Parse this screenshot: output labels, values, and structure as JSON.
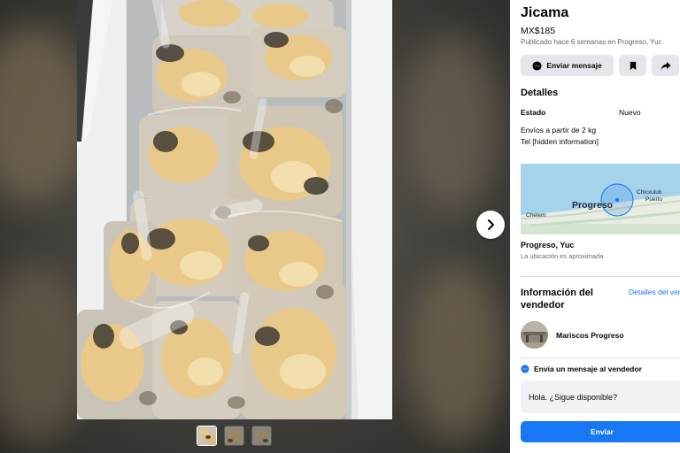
{
  "listing": {
    "title": "Jicama",
    "price": "MX$185",
    "posted": "Publicado hace 6 semanas en Progreso, Yuc"
  },
  "actions": {
    "message_label": "Enviar mensaje",
    "icons": [
      "messenger-icon",
      "bookmark-icon",
      "share-icon"
    ]
  },
  "details": {
    "heading": "Detalles",
    "condition_label": "Estado",
    "condition_value": "Nuevo",
    "description": [
      "Envíos a partir de 2 kg",
      "Tel [hidden information]"
    ]
  },
  "map": {
    "city_label": "Progreso",
    "town1": "Chicxulub",
    "town2": "Puerto",
    "town3": "Chelem"
  },
  "location": {
    "name": "Progreso, Yuc",
    "note": "La ubicación es aproximada"
  },
  "seller": {
    "heading": "Información del vendedor",
    "details_link": "Detalles del vendedor",
    "name": "Mariscos Progreso"
  },
  "message": {
    "heading": "Envía un mensaje al vendedor",
    "input_value": "Hola. ¿Sigue disponible?",
    "send_label": "Enviar"
  },
  "viewer": {
    "thumbnail_count": 3,
    "active_thumbnail": 1
  },
  "colors": {
    "accent": "#1877f2",
    "button_gray": "#e4e6eb",
    "map_water": "#a5d3ea",
    "map_land": "#e8ece3"
  }
}
